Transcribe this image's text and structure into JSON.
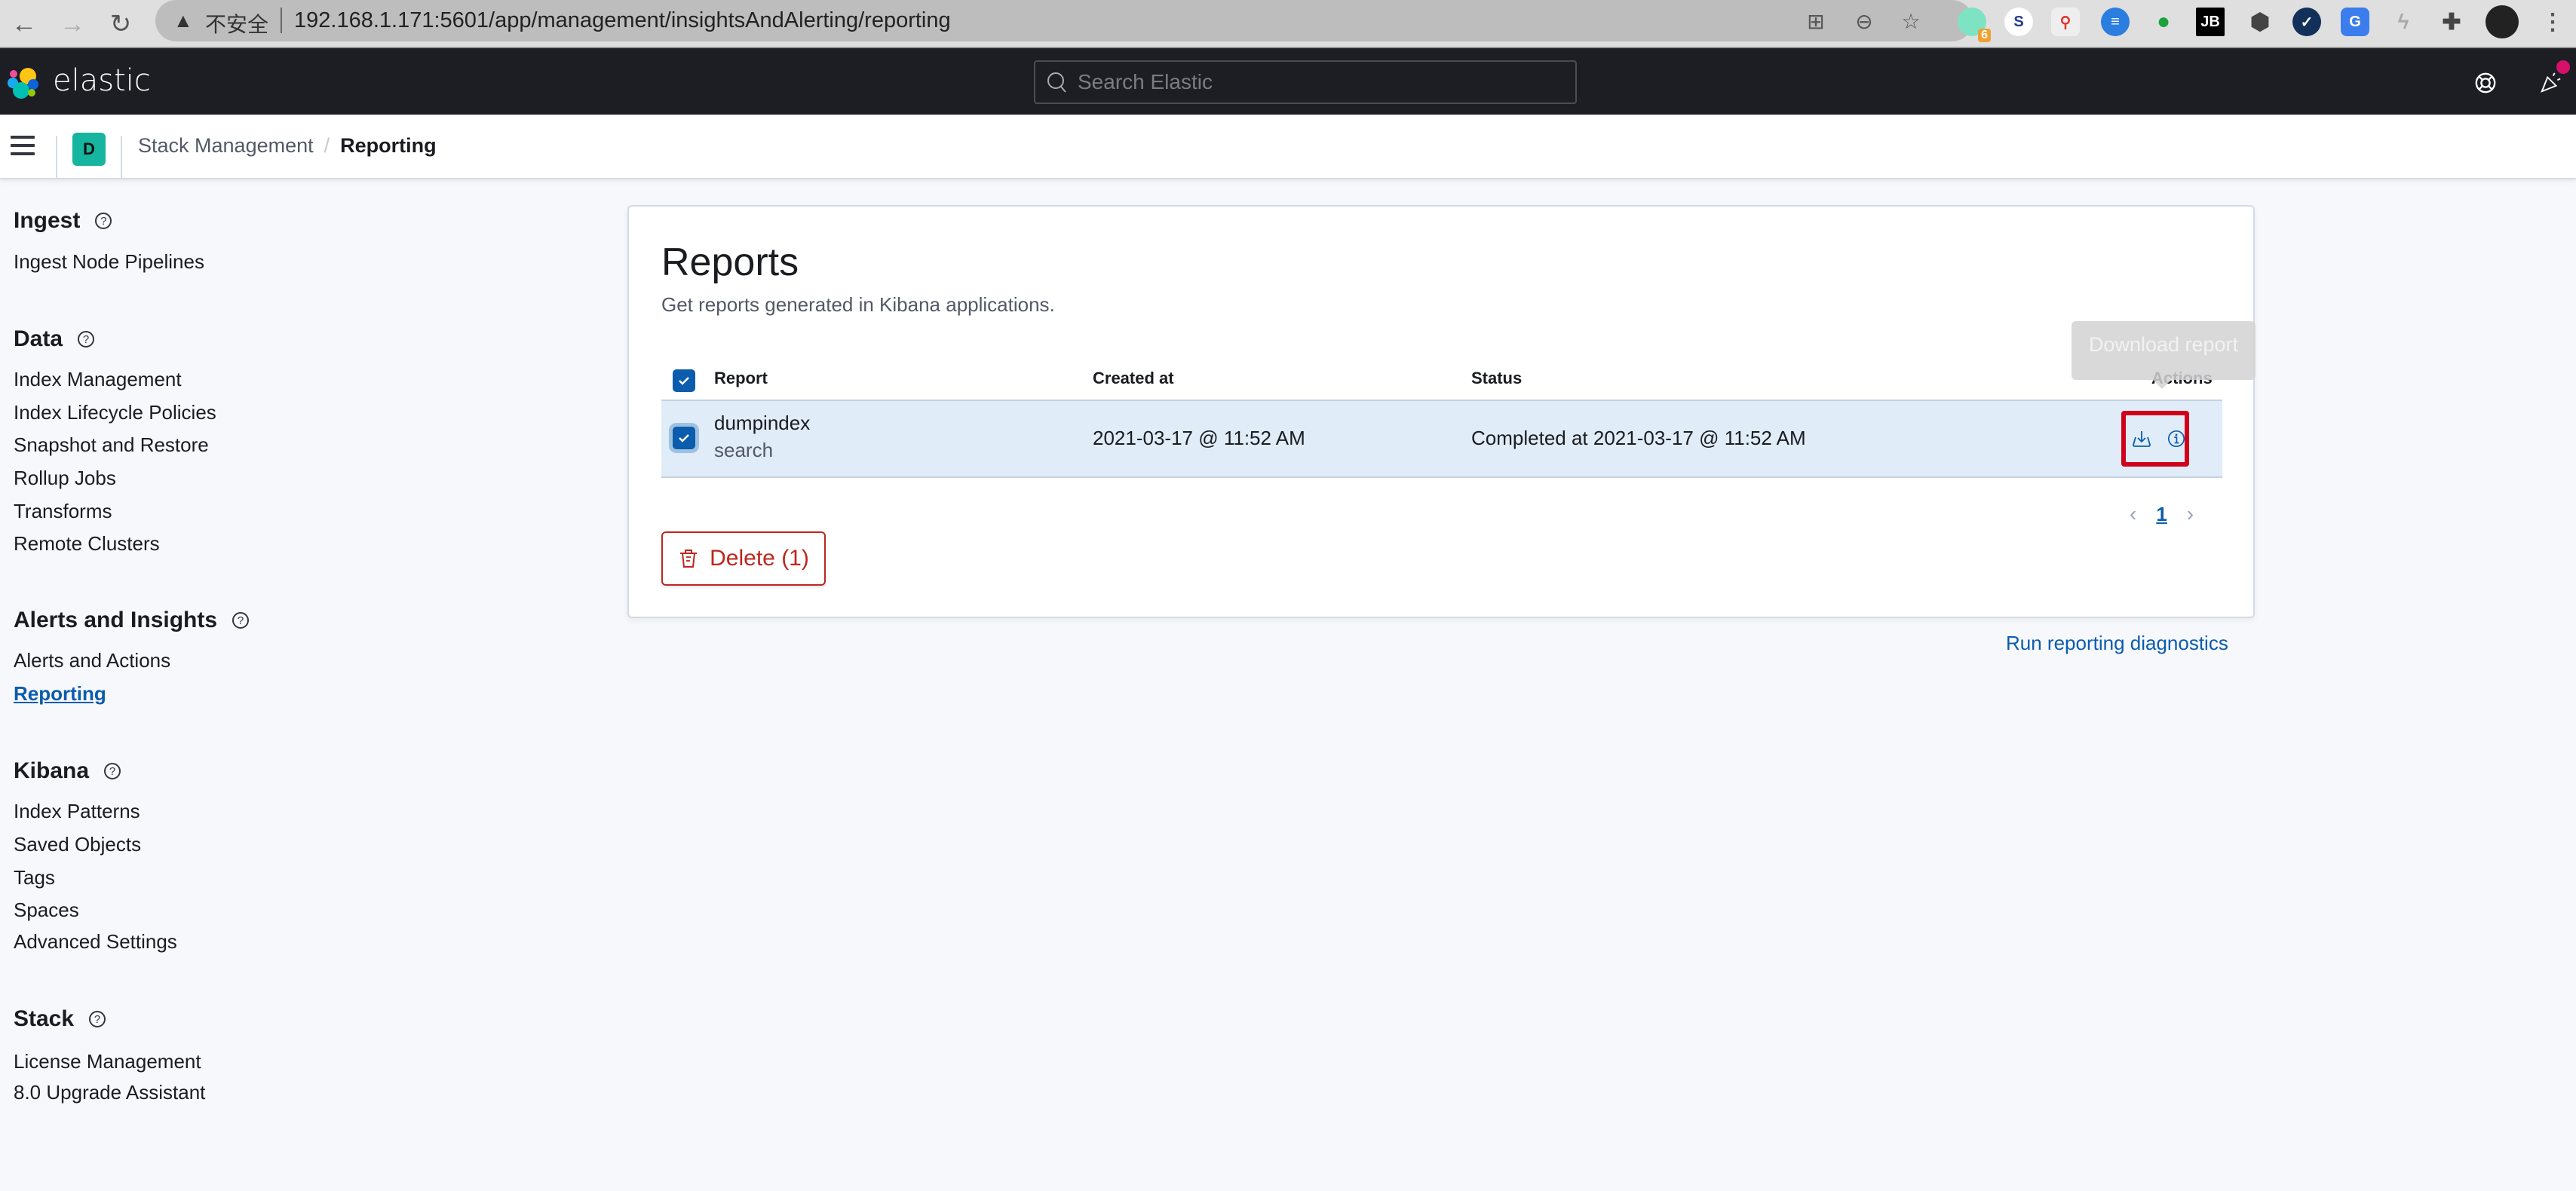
{
  "browser": {
    "insecure_label": "不安全",
    "url": "192.168.1.171:5601/app/management/insightsAndAlerting/reporting",
    "extension_badge": "6"
  },
  "header": {
    "brand": "elastic",
    "search_placeholder": "Search Elastic"
  },
  "breadcrumbs": {
    "space_initial": "D",
    "items": [
      "Stack Management",
      "Reporting"
    ]
  },
  "sidebar": {
    "sections": [
      {
        "title": "Ingest",
        "items": [
          "Ingest Node Pipelines"
        ]
      },
      {
        "title": "Data",
        "items": [
          "Index Management",
          "Index Lifecycle Policies",
          "Snapshot and Restore",
          "Rollup Jobs",
          "Transforms",
          "Remote Clusters"
        ]
      },
      {
        "title": "Alerts and Insights",
        "items": [
          "Alerts and Actions",
          "Reporting"
        ]
      },
      {
        "title": "Kibana",
        "items": [
          "Index Patterns",
          "Saved Objects",
          "Tags",
          "Spaces",
          "Advanced Settings"
        ]
      },
      {
        "title": "Stack",
        "items": [
          "License Management",
          "8.0 Upgrade Assistant"
        ]
      }
    ],
    "active_item": "Reporting"
  },
  "reports": {
    "title": "Reports",
    "subtitle": "Get reports generated in Kibana applications.",
    "columns": [
      "Report",
      "Created at",
      "Status",
      "Actions"
    ],
    "rows": [
      {
        "name": "dumpindex",
        "type": "search",
        "created_at": "2021-03-17 @ 11:52 AM",
        "status": "Completed at 2021-03-17 @ 11:52 AM",
        "selected": true
      }
    ],
    "tooltip": "Download report",
    "pagination": {
      "current_page": "1"
    },
    "delete_label": "Delete (1)",
    "diagnostics_link": "Run reporting diagnostics"
  },
  "colors": {
    "accent": "#0b5cad",
    "danger": "#bd271e",
    "header_bg": "#1d1e24",
    "space_avatar": "#16b5a0",
    "highlight_box": "#d0021b"
  }
}
